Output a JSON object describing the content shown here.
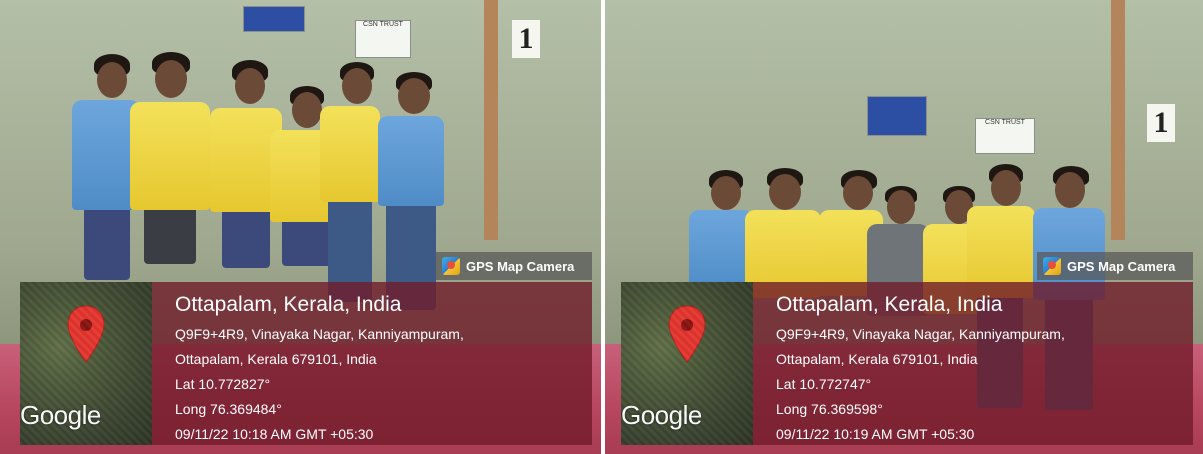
{
  "photos": [
    {
      "signs": {
        "banner": "",
        "notice": "CSN TRUST",
        "number": "1"
      },
      "badge": {
        "label": "GPS Map Camera",
        "icon": "gps-map-camera-icon"
      },
      "map": {
        "brand": "Google",
        "icon": "map-pin-icon"
      },
      "location": {
        "title": "Ottapalam, Kerala, India",
        "address_line1": "Q9F9+4R9, Vinayaka Nagar, Kanniyampuram,",
        "address_line2": "Ottapalam, Kerala 679101, India",
        "lat": "Lat 10.772827°",
        "long": "Long 76.369484°",
        "datetime": "09/11/22 10:18 AM GMT +05:30"
      }
    },
    {
      "signs": {
        "banner": "",
        "notice": "CSN TRUST",
        "number": "1"
      },
      "badge": {
        "label": "GPS Map Camera",
        "icon": "gps-map-camera-icon"
      },
      "map": {
        "brand": "Google",
        "icon": "map-pin-icon"
      },
      "location": {
        "title": "Ottapalam, Kerala, India",
        "address_line1": "Q9F9+4R9, Vinayaka Nagar, Kanniyampuram,",
        "address_line2": "Ottapalam, Kerala 679101, India",
        "lat": "Lat 10.772747°",
        "long": "Long 76.369598°",
        "datetime": "09/11/22 10:19 AM GMT +05:30"
      }
    }
  ],
  "colors": {
    "overlay": "#701c2a",
    "floor": "#b7465e",
    "jersey": "#f3e15a"
  }
}
